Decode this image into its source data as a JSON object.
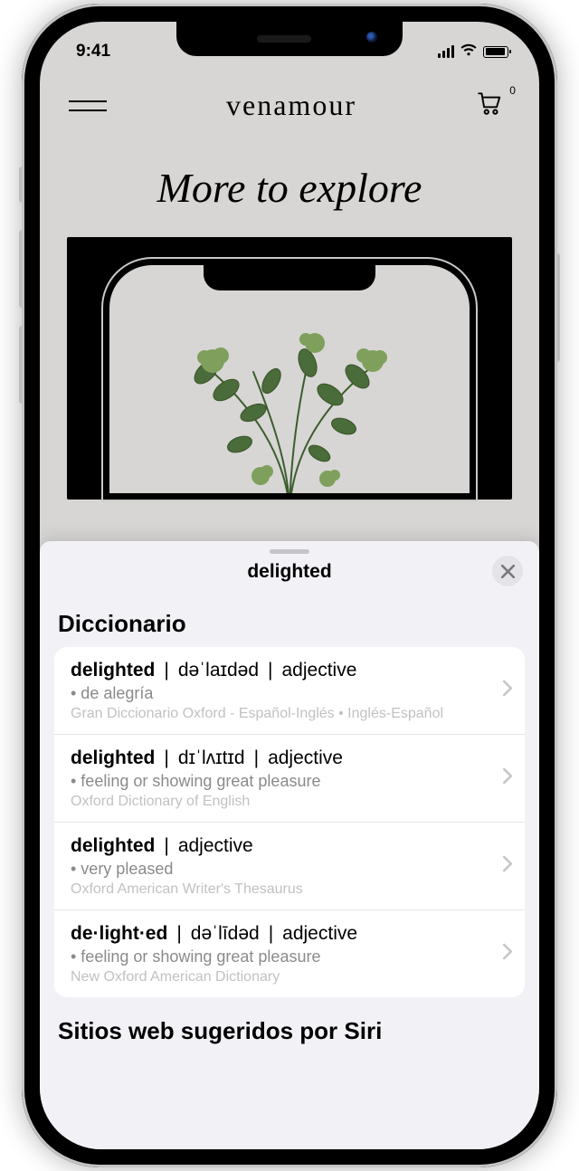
{
  "status": {
    "time": "9:41"
  },
  "header": {
    "brand": "venamour",
    "cart_badge": "0"
  },
  "page": {
    "title": "More to explore"
  },
  "sheet": {
    "title": "delighted",
    "section_dictionary": "Diccionario",
    "section_web": "Sitios web sugeridos por Siri",
    "entries": [
      {
        "word": "delighted",
        "ipa": "dəˈlaɪdəd",
        "pos": "adjective",
        "def": "• de alegría",
        "source": "Gran Diccionario Oxford - Español-Inglés • Inglés-Español"
      },
      {
        "word": "delighted",
        "ipa": "dɪˈlʌɪtɪd",
        "pos": "adjective",
        "def": "• feeling or showing great pleasure",
        "source": "Oxford Dictionary of English"
      },
      {
        "word": "delighted",
        "ipa": "",
        "pos": "adjective",
        "def": "• very pleased",
        "source": "Oxford American Writer's Thesaurus"
      },
      {
        "word": "de·light·ed",
        "ipa": "dəˈlīdəd",
        "pos": "adjective",
        "def": "• feeling or showing great pleasure",
        "source": "New Oxford American Dictionary"
      }
    ]
  }
}
